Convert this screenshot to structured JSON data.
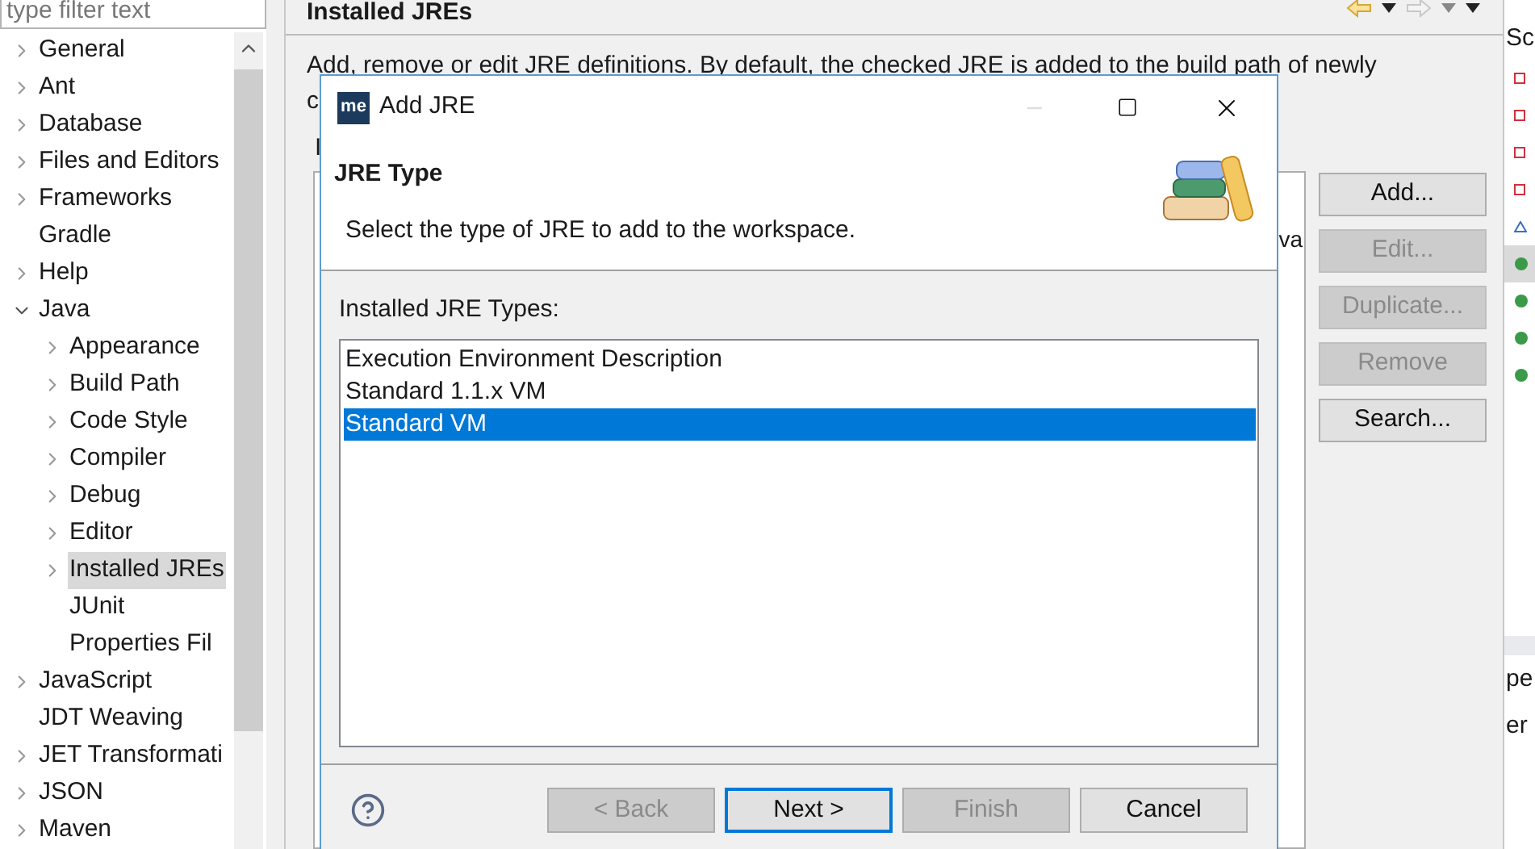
{
  "filter": {
    "placeholder": "type filter text"
  },
  "tree": [
    {
      "label": "General",
      "expanded": false,
      "selected": false
    },
    {
      "label": "Ant",
      "expanded": false,
      "selected": false
    },
    {
      "label": "Database",
      "expanded": false,
      "selected": false
    },
    {
      "label": "Files and Editors",
      "expanded": false,
      "selected": false
    },
    {
      "label": "Frameworks",
      "expanded": false,
      "selected": false
    },
    {
      "label": "Gradle",
      "selected": false
    },
    {
      "label": "Help",
      "expanded": false,
      "selected": false
    },
    {
      "label": "Java",
      "expanded": true,
      "selected": false,
      "children": [
        {
          "label": "Appearance",
          "expanded": false,
          "selected": false
        },
        {
          "label": "Build Path",
          "expanded": false,
          "selected": false
        },
        {
          "label": "Code Style",
          "expanded": false,
          "selected": false
        },
        {
          "label": "Compiler",
          "expanded": false,
          "selected": false
        },
        {
          "label": "Debug",
          "expanded": false,
          "selected": false
        },
        {
          "label": "Editor",
          "expanded": false,
          "selected": false
        },
        {
          "label": "Installed JREs",
          "expanded": false,
          "selected": true
        },
        {
          "label": "JUnit",
          "selected": false
        },
        {
          "label": "Properties Fil",
          "selected": false
        }
      ]
    },
    {
      "label": "JavaScript",
      "expanded": false,
      "selected": false
    },
    {
      "label": "JDT Weaving",
      "selected": false
    },
    {
      "label": "JET Transformati",
      "expanded": false,
      "selected": false
    },
    {
      "label": "JSON",
      "expanded": false,
      "selected": false
    },
    {
      "label": "Maven",
      "expanded": false,
      "selected": false
    }
  ],
  "page": {
    "title": "Installed JREs",
    "description_lines": [
      "Add, remove or edit JRE definitions. By default, the checked JRE is added to the build path of newly",
      "c"
    ],
    "table_label": "I",
    "table_fragment": "va",
    "buttons": [
      {
        "label": "Add...",
        "disabled": false
      },
      {
        "label": "Edit...",
        "disabled": true
      },
      {
        "label": "Duplicate...",
        "disabled": true
      },
      {
        "label": "Remove",
        "disabled": true
      },
      {
        "label": "Search...",
        "disabled": false
      }
    ]
  },
  "right_panel": {
    "heading": "Sc",
    "items": [
      {
        "kind": "square",
        "selected": false
      },
      {
        "kind": "square",
        "selected": false
      },
      {
        "kind": "square",
        "selected": false
      },
      {
        "kind": "square",
        "selected": false
      },
      {
        "kind": "triangle",
        "selected": false
      },
      {
        "kind": "dot",
        "selected": true
      },
      {
        "kind": "dot",
        "selected": false
      },
      {
        "kind": "dot",
        "selected": false
      },
      {
        "kind": "dot",
        "selected": false
      }
    ],
    "fragments": [
      "pe",
      "er"
    ]
  },
  "dialog": {
    "logo_text": "me",
    "title": "Add JRE",
    "heading": "JRE Type",
    "subtitle": "Select the type of JRE to add to the workspace.",
    "list_label": "Installed JRE Types:",
    "jre_types": [
      {
        "label": "Execution Environment Description",
        "selected": false
      },
      {
        "label": "Standard 1.1.x VM",
        "selected": false
      },
      {
        "label": "Standard VM",
        "selected": true
      }
    ],
    "buttons": [
      {
        "label": "< Back",
        "disabled": true,
        "default": false
      },
      {
        "label": "Next >",
        "disabled": false,
        "default": true
      },
      {
        "label": "Finish",
        "disabled": true,
        "default": false
      },
      {
        "label": "Cancel",
        "disabled": false,
        "default": false
      }
    ]
  }
}
